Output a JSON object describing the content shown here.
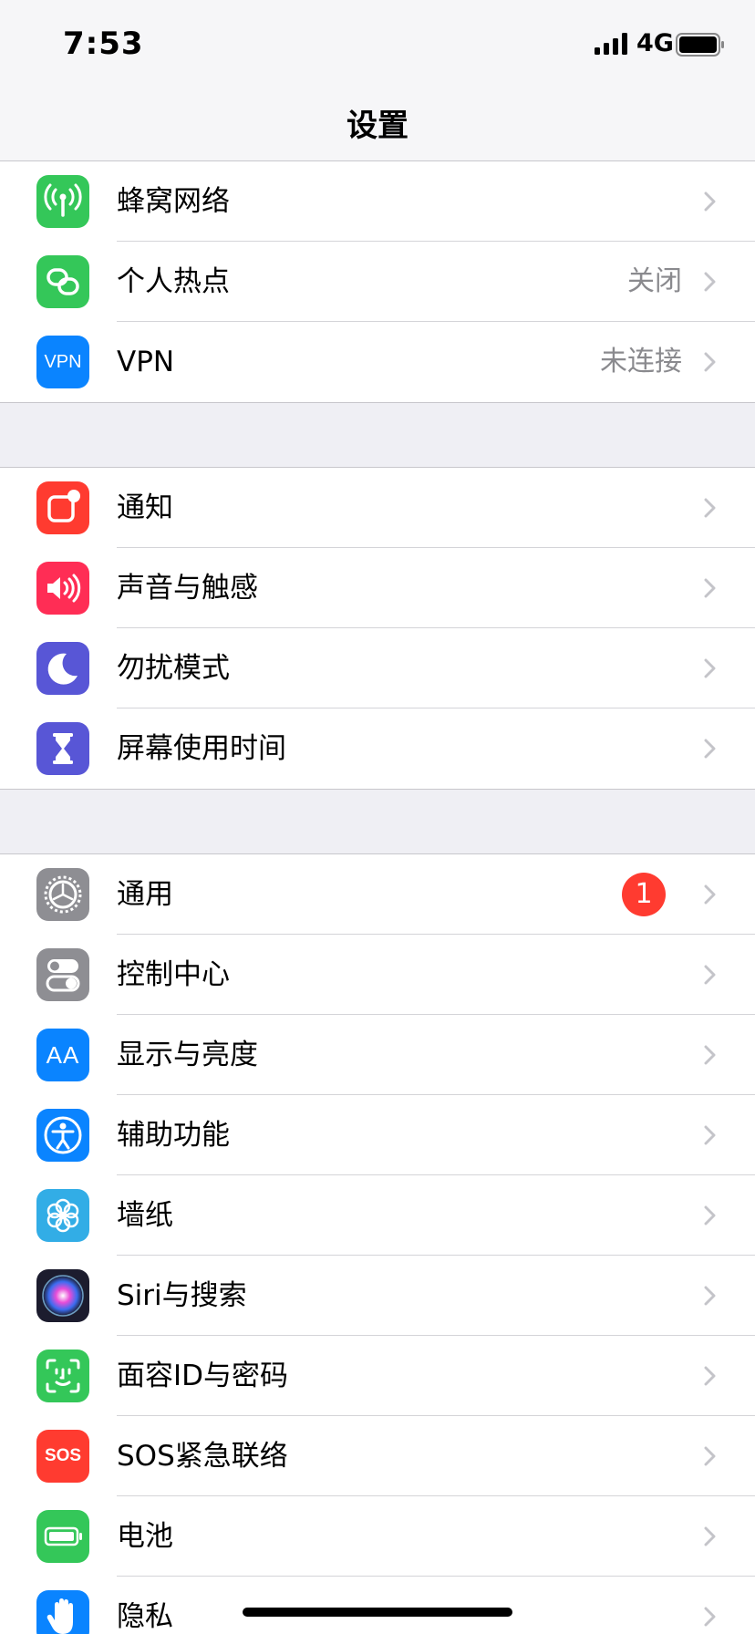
{
  "status_bar": {
    "time": "7:53",
    "network": "4G"
  },
  "nav": {
    "title": "设置"
  },
  "colors": {
    "green": "#34c759",
    "blue": "#0a84ff",
    "red": "#ff3b30",
    "pink": "#ff2d55",
    "indigo": "#5856d6",
    "gray": "#8e8e93",
    "light_blue": "#32ade6",
    "badge_red": "#ff3b30"
  },
  "groups": [
    {
      "items": [
        {
          "label": "蜂窝网络",
          "value": "",
          "icon": "cellular-antenna-icon"
        },
        {
          "label": "个人热点",
          "value": "关闭",
          "icon": "personal-hotspot-icon"
        },
        {
          "label": "VPN",
          "value": "未连接",
          "icon": "vpn-icon",
          "icon_text": "VPN"
        }
      ]
    },
    {
      "items": [
        {
          "label": "通知",
          "value": "",
          "icon": "notifications-icon"
        },
        {
          "label": "声音与触感",
          "value": "",
          "icon": "speaker-icon"
        },
        {
          "label": "勿扰模式",
          "value": "",
          "icon": "moon-icon"
        },
        {
          "label": "屏幕使用时间",
          "value": "",
          "icon": "hourglass-icon"
        }
      ]
    },
    {
      "items": [
        {
          "label": "通用",
          "value": "",
          "icon": "gear-icon",
          "badge": "1"
        },
        {
          "label": "控制中心",
          "value": "",
          "icon": "toggles-icon"
        },
        {
          "label": "显示与亮度",
          "value": "",
          "icon": "text-size-icon",
          "icon_text": "AA"
        },
        {
          "label": "辅助功能",
          "value": "",
          "icon": "accessibility-icon"
        },
        {
          "label": "墙纸",
          "value": "",
          "icon": "flower-icon"
        },
        {
          "label": "Siri与搜索",
          "value": "",
          "icon": "siri-icon"
        },
        {
          "label": "面容ID与密码",
          "value": "",
          "icon": "face-id-icon"
        },
        {
          "label": "SOS紧急联络",
          "value": "",
          "icon": "sos-icon",
          "icon_text": "SOS"
        },
        {
          "label": "电池",
          "value": "",
          "icon": "battery-icon"
        },
        {
          "label": "隐私",
          "value": "",
          "icon": "hand-icon"
        }
      ]
    }
  ]
}
